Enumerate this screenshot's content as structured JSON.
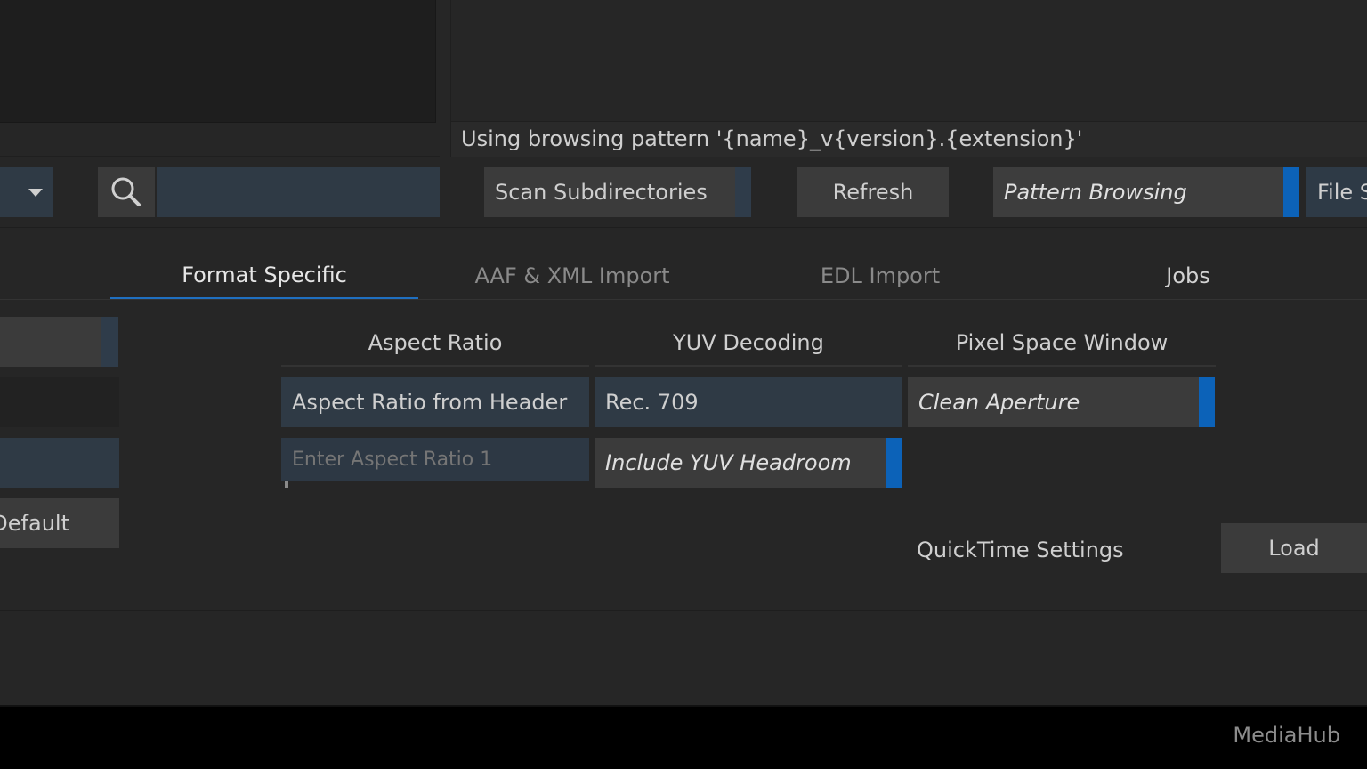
{
  "status_message": "Using browsing pattern '{name}_v{version}.{extension}'",
  "toolbar": {
    "search_placeholder": "",
    "scan_subdirectories": "Scan Subdirectories",
    "refresh": "Refresh",
    "pattern_browsing": "Pattern Browsing",
    "file_partial": "File S"
  },
  "tabs": [
    {
      "label": "Format Specific",
      "active": true
    },
    {
      "label": "AAF & XML Import",
      "active": false
    },
    {
      "label": "EDL Import",
      "active": false
    },
    {
      "label": "Jobs",
      "active": false
    }
  ],
  "left_panel": {
    "default_button": "Default"
  },
  "format": {
    "aspect_ratio": {
      "header": "Aspect Ratio",
      "mode": "Aspect Ratio from Header",
      "input_placeholder": "Enter Aspect Ratio 1"
    },
    "yuv_decoding": {
      "header": "YUV Decoding",
      "value": "Rec. 709",
      "headroom_toggle": "Include YUV Headroom"
    },
    "pixel_space_window": {
      "header": "Pixel Space Window",
      "value": "Clean Aperture"
    }
  },
  "quicktime": {
    "label": "QuickTime Settings",
    "load_button": "Load"
  },
  "app_name": "MediaHub"
}
